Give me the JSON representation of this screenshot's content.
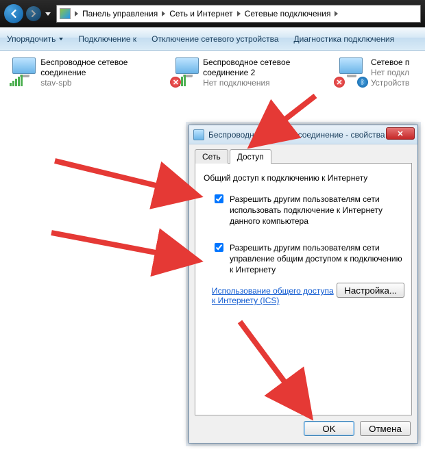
{
  "navbar": {
    "breadcrumb": [
      "Панель управления",
      "Сеть и Интернет",
      "Сетевые подключения"
    ]
  },
  "cmdbar": {
    "organize": "Упорядочить",
    "connect": "Подключение к",
    "disable": "Отключение сетевого устройства",
    "diagnose": "Диагностика подключения"
  },
  "adapters": [
    {
      "title": "Беспроводное сетевое соединение",
      "sub": "stav-spb",
      "disabled": false,
      "bluetooth": false
    },
    {
      "title": "Беспроводное сетевое соединение 2",
      "sub": "Нет подключения",
      "disabled": true,
      "bluetooth": false
    },
    {
      "title": "Сетевое п",
      "sub1": "Нет подкл",
      "sub2": "Устройств",
      "disabled": true,
      "bluetooth": true
    }
  ],
  "dialog": {
    "title": "Беспроводное сетевое соединение - свойства",
    "tabs": {
      "network": "Сеть",
      "sharing": "Доступ"
    },
    "group_title": "Общий доступ к подключению к Интернету",
    "check1": "Разрешить другим пользователям сети использовать подключение к Интернету данного компьютера",
    "check2": "Разрешить другим пользователям сети управление общим доступом к подключению к Интернету",
    "link": "Использование общего доступа к Интернету (ICS)",
    "settings": "Настройка...",
    "ok": "OK",
    "cancel": "Отмена"
  }
}
